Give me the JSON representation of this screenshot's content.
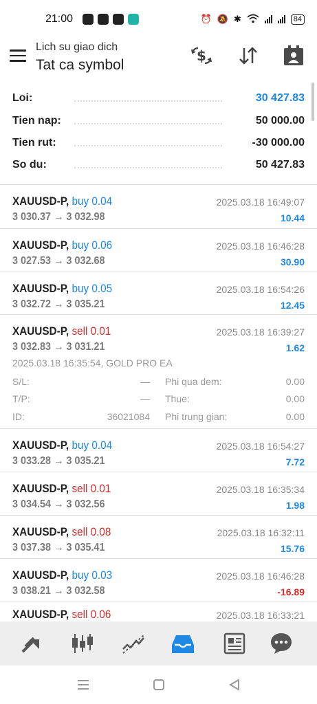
{
  "status": {
    "time": "21:00",
    "battery": "84"
  },
  "app_bar": {
    "subtitle": "Lich su giao dich",
    "title": "Tat ca symbol"
  },
  "summary": {
    "items": [
      {
        "label": "Loi:",
        "value": "30 427.83",
        "color": "#1e88e5"
      },
      {
        "label": "Tien nap:",
        "value": "50 000.00",
        "color": "#222222"
      },
      {
        "label": "Tien rut:",
        "value": "-30 000.00",
        "color": "#222222"
      },
      {
        "label": "So du:",
        "value": "50 427.83",
        "color": "#222222"
      }
    ]
  },
  "deals": [
    {
      "symbol": "XAUUSD-P,",
      "side": "buy 0.04",
      "price": "3 030.37 → 3 032.98",
      "time": "2025.03.18 16:49:07",
      "profit": "10.44"
    },
    {
      "symbol": "XAUUSD-P,",
      "side": "buy 0.06",
      "price": "3 027.53 → 3 032.68",
      "time": "2025.03.18 16:46:28",
      "profit": "30.90"
    },
    {
      "symbol": "XAUUSD-P,",
      "side": "buy 0.05",
      "price": "3 032.72 → 3 035.21",
      "time": "2025.03.18 16:54:26",
      "profit": "12.45"
    },
    {
      "symbol": "XAUUSD-P,",
      "side": "sell 0.01",
      "price": "3 032.83 → 3 031.21",
      "time": "2025.03.18 16:39:27",
      "profit": "1.62"
    },
    {
      "symbol": "XAUUSD-P,",
      "side": "buy 0.04",
      "price": "3 033.28 → 3 035.21",
      "time": "2025.03.18 16:54:27",
      "profit": "7.72"
    },
    {
      "symbol": "XAUUSD-P,",
      "side": "sell 0.01",
      "price": "3 034.54 → 3 032.56",
      "time": "2025.03.18 16:35:34",
      "profit": "1.98"
    },
    {
      "symbol": "XAUUSD-P,",
      "side": "sell 0.08",
      "price": "3 037.38 → 3 035.41",
      "time": "2025.03.18 16:32:11",
      "profit": "15.76"
    },
    {
      "symbol": "XAUUSD-P,",
      "side": "buy 0.03",
      "price": "3 038.21 → 3 032.58",
      "time": "2025.03.18 16:46:28",
      "profit": "-16.89"
    },
    {
      "symbol": "XAUUSD-P,",
      "side": "sell 0.06",
      "price": "",
      "time": "2025.03.18 16:33:21",
      "profit": ""
    }
  ],
  "expanded_detail": {
    "open_line": "2025.03.18 16:35:54, GOLD PRO EA",
    "sl_label": "S/L:",
    "sl_value": "—",
    "overnight_label": "Phi qua dem:",
    "overnight_value": "0.00",
    "tp_label": "T/P:",
    "tp_value": "—",
    "tax_label": "Thue:",
    "tax_value": "0.00",
    "id_label": "ID:",
    "id_value": "36021084",
    "broker_fee_label": "Phi trung gian:",
    "broker_fee_value": "0.00"
  },
  "bottom_nav": {
    "active_color": "#1e88e5",
    "items": [
      "quotes-icon",
      "chart-icon",
      "trade-icon",
      "history-icon",
      "news-icon",
      "chat-icon"
    ]
  },
  "colors": {
    "buy": "#1e88e5",
    "sell": "#d32f2f",
    "profit_positive": "#1e88e5",
    "profit_negative": "#d32f2f"
  }
}
